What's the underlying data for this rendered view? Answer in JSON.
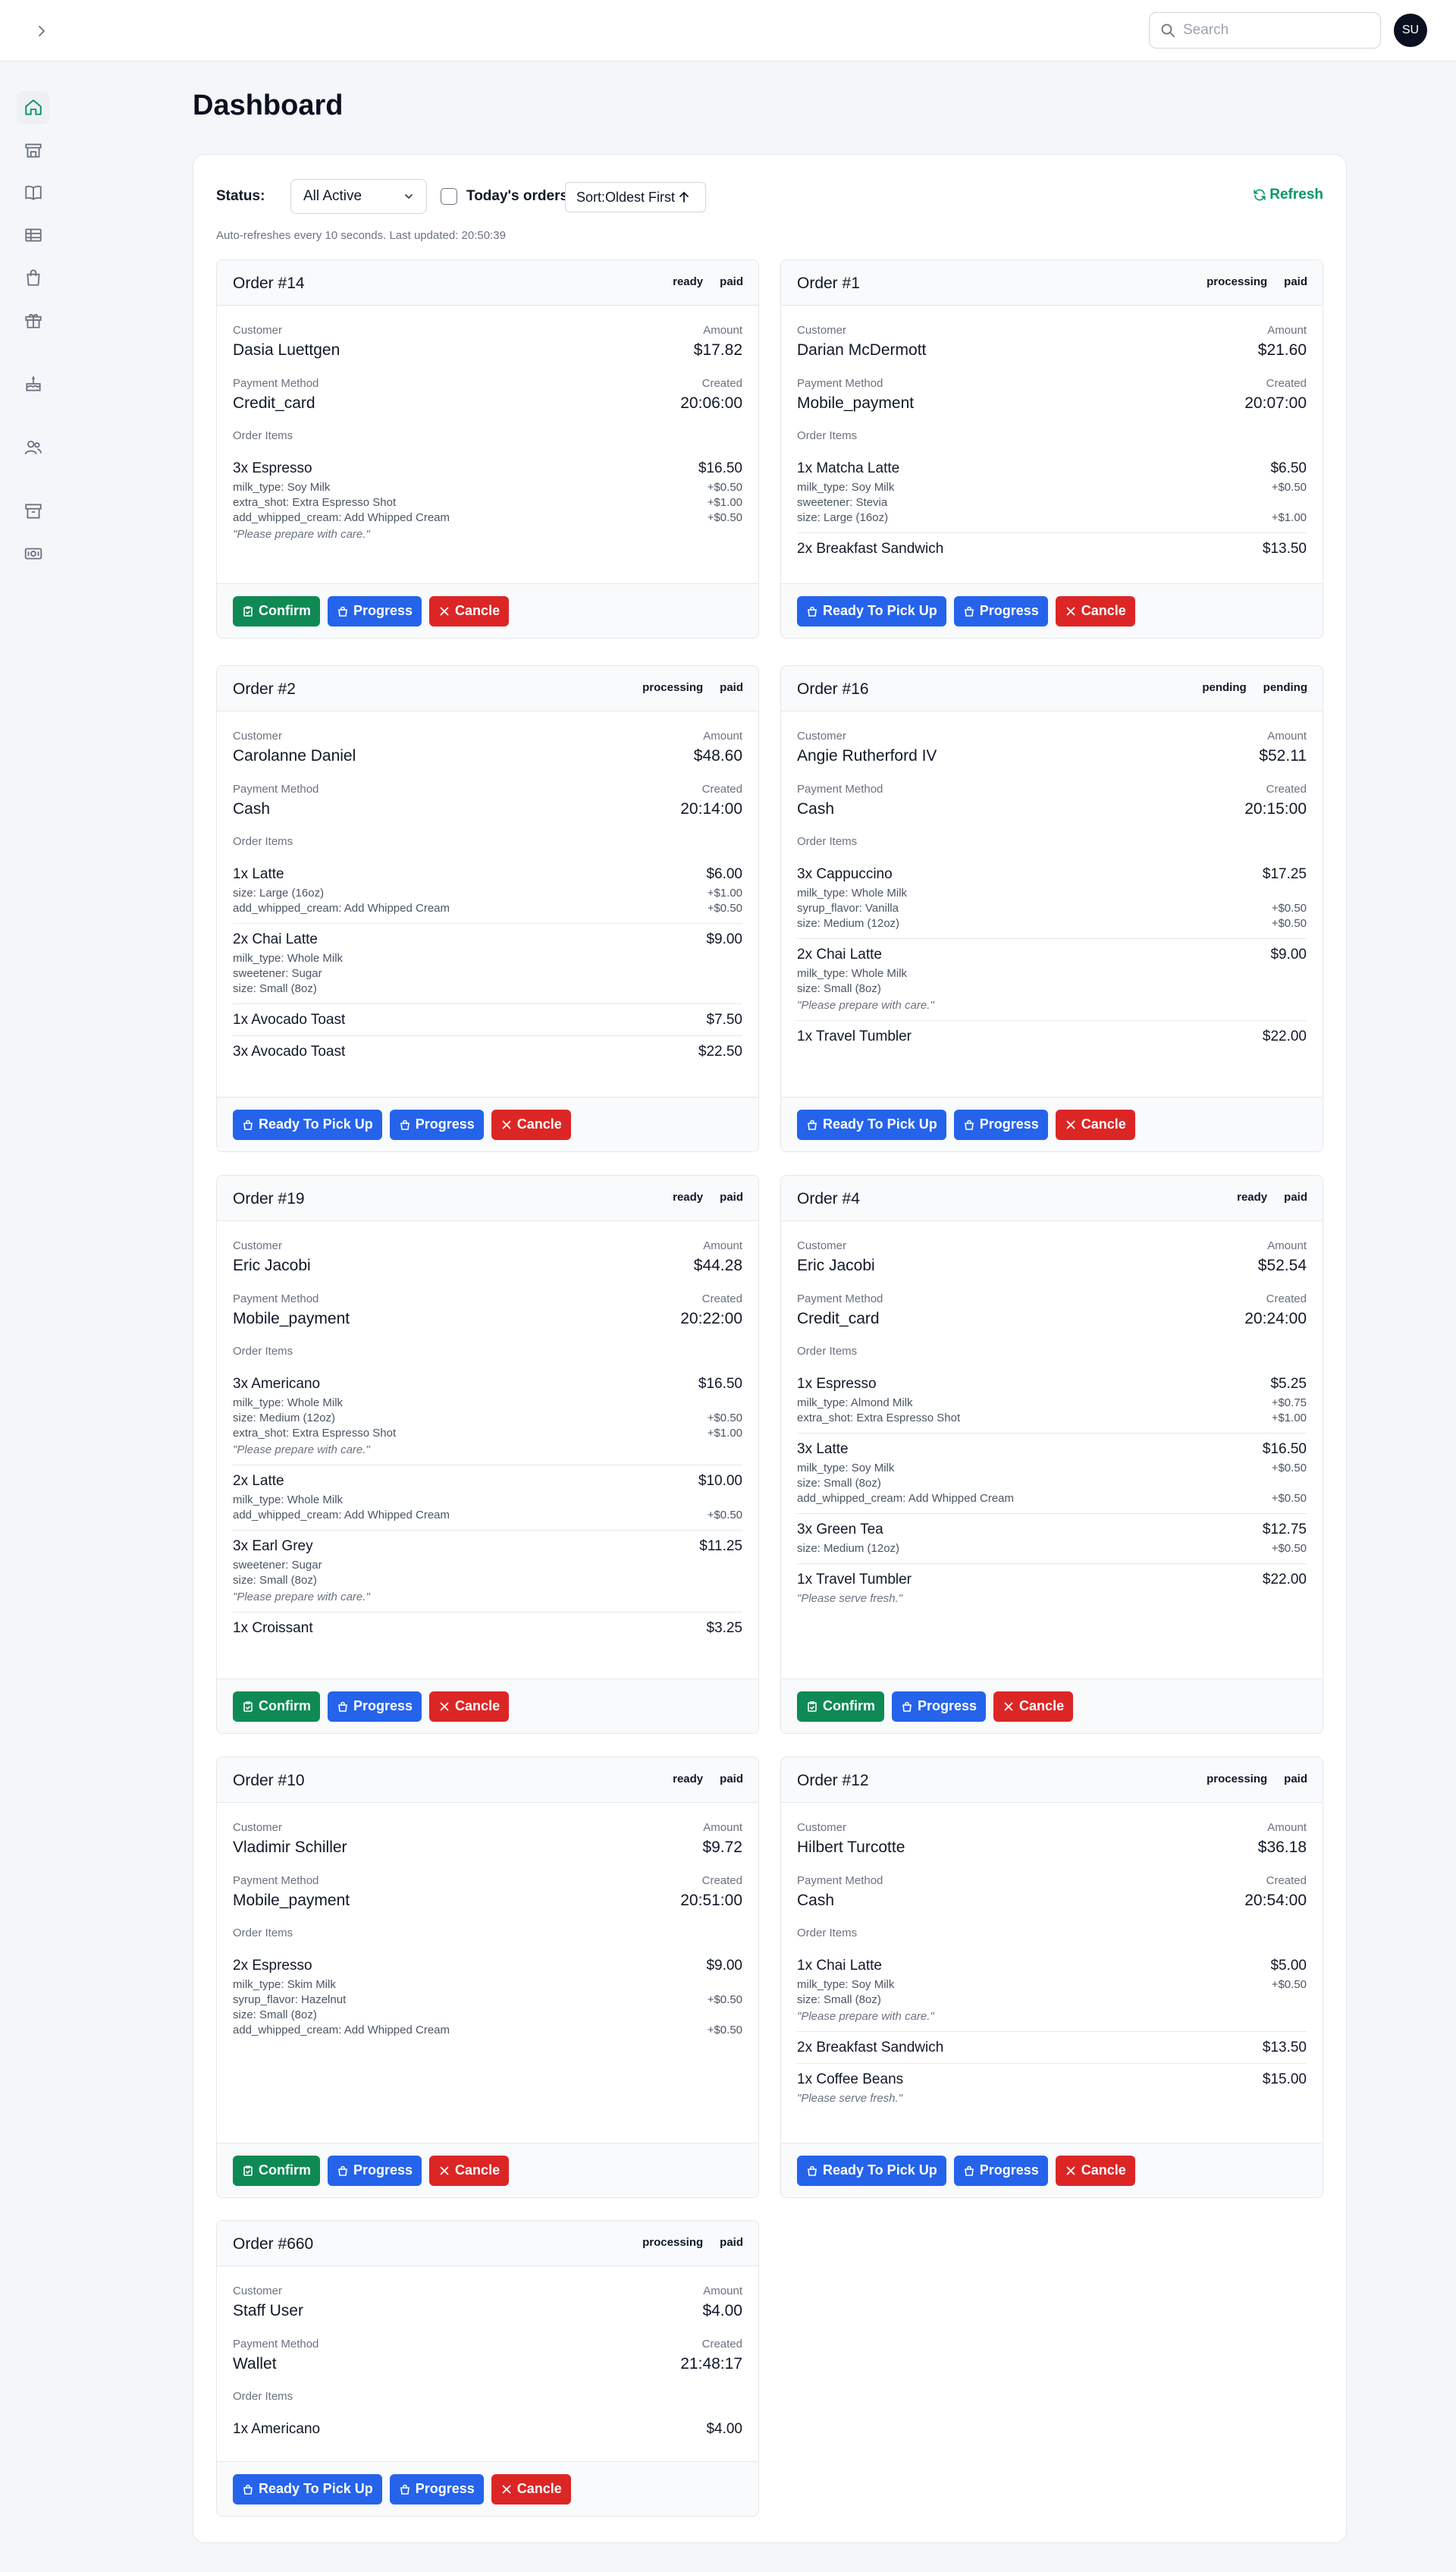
{
  "header": {
    "search_placeholder": "Search",
    "avatar_initials": "SU"
  },
  "sidebar": [
    "home-icon",
    "store-icon",
    "book-icon",
    "table-icon",
    "shopping-bag-icon",
    "gift-icon",
    "cake-icon",
    "users-icon",
    "archive-icon",
    "cash-icon"
  ],
  "page": {
    "title": "Dashboard"
  },
  "controls": {
    "status_label": "Status:",
    "status_value": "All Active",
    "todays_orders": "Today's orders",
    "sort_label": "Sort:Oldest First",
    "refresh": "Refresh",
    "auto_note": "Auto-refreshes every 10 seconds. Last updated: 20:50:39"
  },
  "labels": {
    "customer": "Customer",
    "amount": "Amount",
    "payment_method": "Payment Method",
    "created": "Created",
    "order_items": "Order Items"
  },
  "orders": [
    {
      "title": "Order #14",
      "status": "ready",
      "payment": "paid",
      "customer": "Dasia Luettgen",
      "amount": "$17.82",
      "method": "Credit_card",
      "created": "20:06:00",
      "items": [
        {
          "name": "3x Espresso",
          "price": "$16.50",
          "options": [
            {
              "label": "milk_type: Soy Milk",
              "price": "+$0.50"
            },
            {
              "label": "extra_shot: Extra Espresso Shot",
              "price": "+$1.00"
            },
            {
              "label": "add_whipped_cream: Add Whipped Cream",
              "price": "+$0.50"
            }
          ],
          "note": "\"Please prepare with care.\""
        }
      ],
      "buttons": [
        {
          "kind": "confirm",
          "label": "Confirm"
        },
        {
          "kind": "progress",
          "label": "Progress"
        },
        {
          "kind": "cancel",
          "label": "Cancle"
        }
      ]
    },
    {
      "title": "Order #1",
      "status": "processing",
      "payment": "paid",
      "customer": "Darian McDermott",
      "amount": "$21.60",
      "method": "Mobile_payment",
      "created": "20:07:00",
      "items": [
        {
          "name": "1x Matcha Latte",
          "price": "$6.50",
          "options": [
            {
              "label": "milk_type: Soy Milk",
              "price": "+$0.50"
            },
            {
              "label": "sweetener: Stevia",
              "price": ""
            },
            {
              "label": "size: Large (16oz)",
              "price": "+$1.00"
            }
          ]
        },
        {
          "name": "2x Breakfast Sandwich",
          "price": "$13.50",
          "options": []
        }
      ],
      "buttons": [
        {
          "kind": "ready",
          "label": "Ready To Pick Up"
        },
        {
          "kind": "progress",
          "label": "Progress"
        },
        {
          "kind": "cancel",
          "label": "Cancle"
        }
      ]
    },
    {
      "title": "Order #2",
      "status": "processing",
      "payment": "paid",
      "customer": "Carolanne Daniel",
      "amount": "$48.60",
      "method": "Cash",
      "created": "20:14:00",
      "items": [
        {
          "name": "1x Latte",
          "price": "$6.00",
          "options": [
            {
              "label": "size: Large (16oz)",
              "price": "+$1.00"
            },
            {
              "label": "add_whipped_cream: Add Whipped Cream",
              "price": "+$0.50"
            }
          ]
        },
        {
          "name": "2x Chai Latte",
          "price": "$9.00",
          "options": [
            {
              "label": "milk_type: Whole Milk",
              "price": ""
            },
            {
              "label": "sweetener: Sugar",
              "price": ""
            },
            {
              "label": "size: Small (8oz)",
              "price": ""
            }
          ]
        },
        {
          "name": "1x Avocado Toast",
          "price": "$7.50",
          "options": []
        },
        {
          "name": "3x Avocado Toast",
          "price": "$22.50",
          "options": []
        }
      ],
      "buttons": [
        {
          "kind": "ready",
          "label": "Ready To Pick Up"
        },
        {
          "kind": "progress",
          "label": "Progress"
        },
        {
          "kind": "cancel",
          "label": "Cancle"
        }
      ]
    },
    {
      "title": "Order #16",
      "status": "pending",
      "payment": "pending",
      "customer": "Angie Rutherford IV",
      "amount": "$52.11",
      "method": "Cash",
      "created": "20:15:00",
      "items": [
        {
          "name": "3x Cappuccino",
          "price": "$17.25",
          "options": [
            {
              "label": "milk_type: Whole Milk",
              "price": ""
            },
            {
              "label": "syrup_flavor: Vanilla",
              "price": "+$0.50"
            },
            {
              "label": "size: Medium (12oz)",
              "price": "+$0.50"
            }
          ]
        },
        {
          "name": "2x Chai Latte",
          "price": "$9.00",
          "options": [
            {
              "label": "milk_type: Whole Milk",
              "price": ""
            },
            {
              "label": "size: Small (8oz)",
              "price": ""
            }
          ],
          "note": "\"Please prepare with care.\""
        },
        {
          "name": "1x Travel Tumbler",
          "price": "$22.00",
          "options": []
        }
      ],
      "buttons": [
        {
          "kind": "ready",
          "label": "Ready To Pick Up"
        },
        {
          "kind": "progress",
          "label": "Progress"
        },
        {
          "kind": "cancel",
          "label": "Cancle"
        }
      ]
    },
    {
      "title": "Order #19",
      "status": "ready",
      "payment": "paid",
      "customer": "Eric Jacobi",
      "amount": "$44.28",
      "method": "Mobile_payment",
      "created": "20:22:00",
      "items": [
        {
          "name": "3x Americano",
          "price": "$16.50",
          "options": [
            {
              "label": "milk_type: Whole Milk",
              "price": ""
            },
            {
              "label": "size: Medium (12oz)",
              "price": "+$0.50"
            },
            {
              "label": "extra_shot: Extra Espresso Shot",
              "price": "+$1.00"
            }
          ],
          "note": "\"Please prepare with care.\""
        },
        {
          "name": "2x Latte",
          "price": "$10.00",
          "options": [
            {
              "label": "milk_type: Whole Milk",
              "price": ""
            },
            {
              "label": "add_whipped_cream: Add Whipped Cream",
              "price": "+$0.50"
            }
          ]
        },
        {
          "name": "3x Earl Grey",
          "price": "$11.25",
          "options": [
            {
              "label": "sweetener: Sugar",
              "price": ""
            },
            {
              "label": "size: Small (8oz)",
              "price": ""
            }
          ],
          "note": "\"Please prepare with care.\""
        },
        {
          "name": "1x Croissant",
          "price": "$3.25",
          "options": []
        }
      ],
      "buttons": [
        {
          "kind": "confirm",
          "label": "Confirm"
        },
        {
          "kind": "progress",
          "label": "Progress"
        },
        {
          "kind": "cancel",
          "label": "Cancle"
        }
      ]
    },
    {
      "title": "Order #4",
      "status": "ready",
      "payment": "paid",
      "customer": "Eric Jacobi",
      "amount": "$52.54",
      "method": "Credit_card",
      "created": "20:24:00",
      "items": [
        {
          "name": "1x Espresso",
          "price": "$5.25",
          "options": [
            {
              "label": "milk_type: Almond Milk",
              "price": "+$0.75"
            },
            {
              "label": "extra_shot: Extra Espresso Shot",
              "price": "+$1.00"
            }
          ]
        },
        {
          "name": "3x Latte",
          "price": "$16.50",
          "options": [
            {
              "label": "milk_type: Soy Milk",
              "price": "+$0.50"
            },
            {
              "label": "size: Small (8oz)",
              "price": ""
            },
            {
              "label": "add_whipped_cream: Add Whipped Cream",
              "price": "+$0.50"
            }
          ]
        },
        {
          "name": "3x Green Tea",
          "price": "$12.75",
          "options": [
            {
              "label": "size: Medium (12oz)",
              "price": "+$0.50"
            }
          ]
        },
        {
          "name": "1x Travel Tumbler",
          "price": "$22.00",
          "options": [],
          "note": "\"Please serve fresh.\""
        }
      ],
      "buttons": [
        {
          "kind": "confirm",
          "label": "Confirm"
        },
        {
          "kind": "progress",
          "label": "Progress"
        },
        {
          "kind": "cancel",
          "label": "Cancle"
        }
      ]
    },
    {
      "title": "Order #10",
      "status": "ready",
      "payment": "paid",
      "customer": "Vladimir Schiller",
      "amount": "$9.72",
      "method": "Mobile_payment",
      "created": "20:51:00",
      "items": [
        {
          "name": "2x Espresso",
          "price": "$9.00",
          "options": [
            {
              "label": "milk_type: Skim Milk",
              "price": ""
            },
            {
              "label": "syrup_flavor: Hazelnut",
              "price": "+$0.50"
            },
            {
              "label": "size: Small (8oz)",
              "price": ""
            },
            {
              "label": "add_whipped_cream: Add Whipped Cream",
              "price": "+$0.50"
            }
          ]
        }
      ],
      "buttons": [
        {
          "kind": "confirm",
          "label": "Confirm"
        },
        {
          "kind": "progress",
          "label": "Progress"
        },
        {
          "kind": "cancel",
          "label": "Cancle"
        }
      ]
    },
    {
      "title": "Order #12",
      "status": "processing",
      "payment": "paid",
      "customer": "Hilbert Turcotte",
      "amount": "$36.18",
      "method": "Cash",
      "created": "20:54:00",
      "items": [
        {
          "name": "1x Chai Latte",
          "price": "$5.00",
          "options": [
            {
              "label": "milk_type: Soy Milk",
              "price": "+$0.50"
            },
            {
              "label": "size: Small (8oz)",
              "price": ""
            }
          ],
          "note": "\"Please prepare with care.\""
        },
        {
          "name": "2x Breakfast Sandwich",
          "price": "$13.50",
          "options": []
        },
        {
          "name": "1x Coffee Beans",
          "price": "$15.00",
          "options": [],
          "note": "\"Please serve fresh.\""
        }
      ],
      "buttons": [
        {
          "kind": "ready",
          "label": "Ready To Pick Up"
        },
        {
          "kind": "progress",
          "label": "Progress"
        },
        {
          "kind": "cancel",
          "label": "Cancle"
        }
      ]
    },
    {
      "title": "Order #660",
      "status": "processing",
      "payment": "paid",
      "customer": "Staff User",
      "amount": "$4.00",
      "method": "Wallet",
      "created": "21:48:17",
      "items": [
        {
          "name": "1x Americano",
          "price": "$4.00",
          "options": []
        }
      ],
      "buttons": [
        {
          "kind": "ready",
          "label": "Ready To Pick Up"
        },
        {
          "kind": "progress",
          "label": "Progress"
        },
        {
          "kind": "cancel",
          "label": "Cancle"
        }
      ]
    }
  ]
}
